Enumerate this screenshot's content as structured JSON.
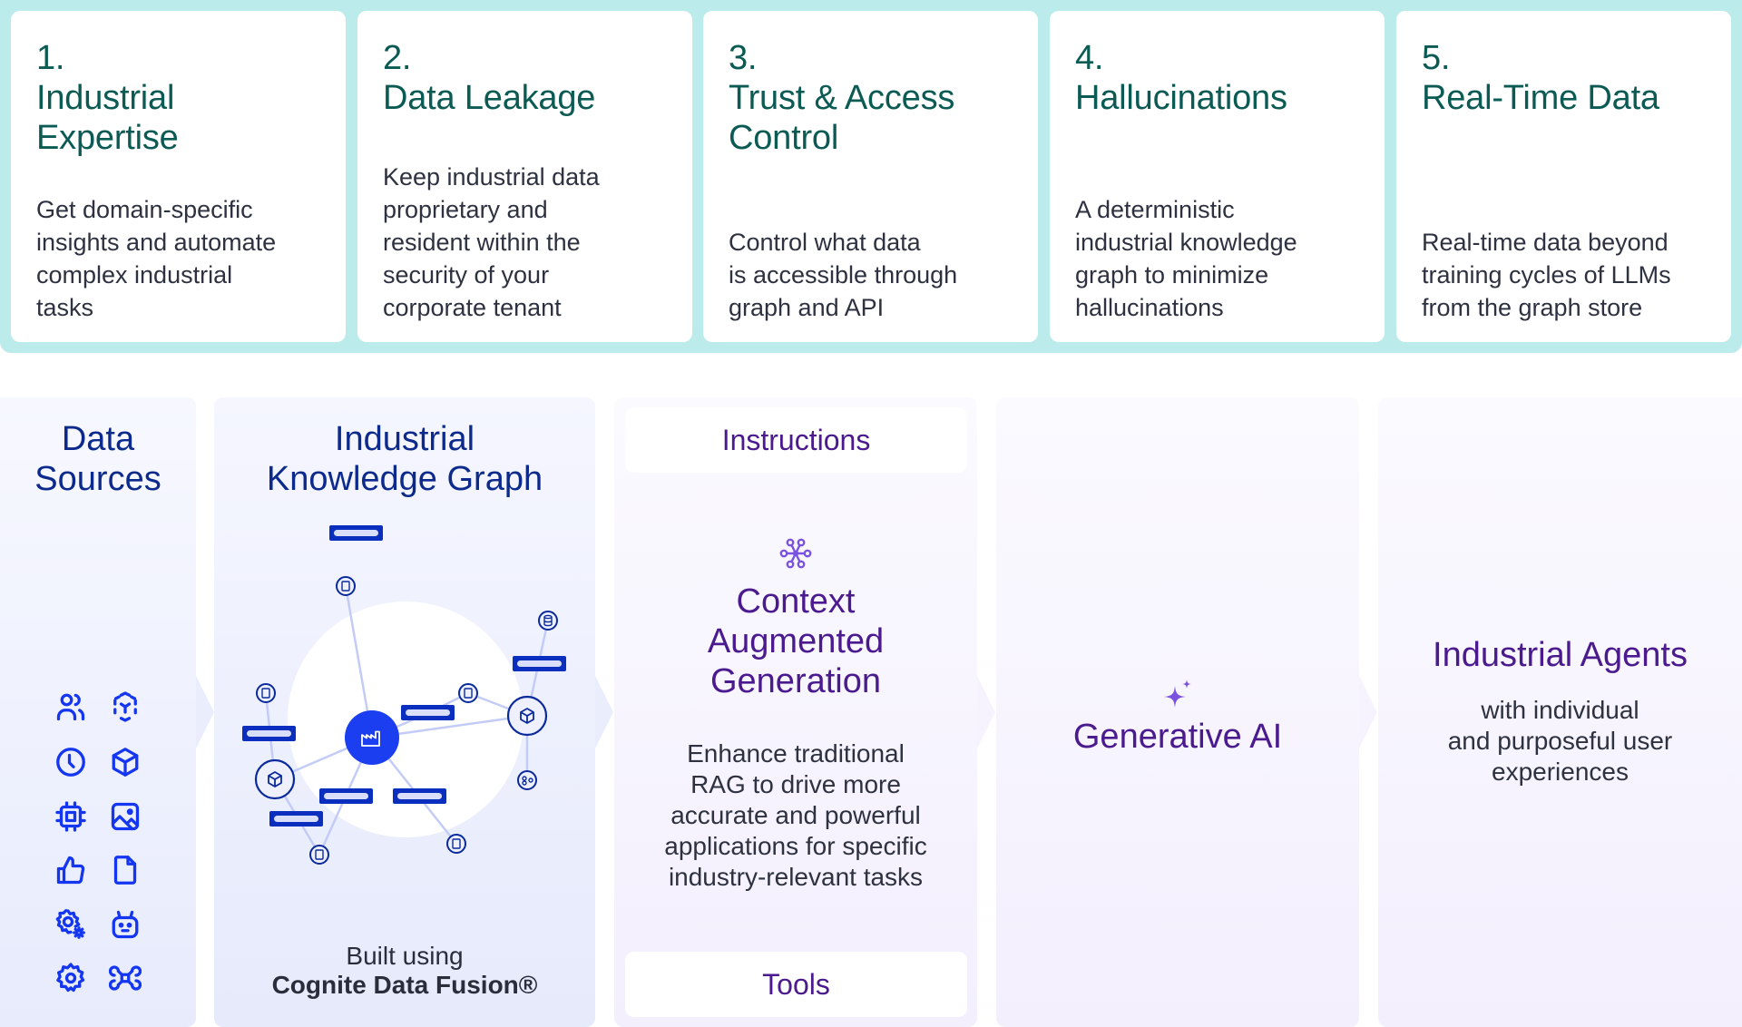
{
  "challenges": [
    {
      "number": "1.",
      "title": "Industrial\nExpertise",
      "description": "Get domain-specific\ninsights and automate\ncomplex industrial\ntasks"
    },
    {
      "number": "2.",
      "title": "Data Leakage",
      "description": "Keep industrial data\nproprietary and\nresident within the\nsecurity of your\ncorporate tenant"
    },
    {
      "number": "3.",
      "title": "Trust & Access\nControl",
      "description": "Control what data\nis accessible through\ngraph and API"
    },
    {
      "number": "4.",
      "title": "Hallucinations",
      "description": "A deterministic\nindustrial knowledge\ngraph to minimize\nhallucinations"
    },
    {
      "number": "5.",
      "title": "Real-Time Data",
      "description": "Real-time data beyond\ntraining cycles of LLMs\nfrom the graph store"
    }
  ],
  "data_sources": {
    "title": "Data\nSources",
    "icons": [
      "users-icon",
      "3d-scan-icon",
      "clock-icon",
      "cube-icon",
      "chip-icon",
      "image-icon",
      "thumbs-up-icon",
      "file-icon",
      "settings-cog-icon",
      "robot-icon",
      "gear-icon",
      "drone-icon"
    ]
  },
  "knowledge_graph": {
    "title": "Industrial\nKnowledge Graph",
    "hub_icon": "factory-icon",
    "built_using": "Built using",
    "product": "Cognite Data Fusion®"
  },
  "cag": {
    "instructions": "Instructions",
    "icon": "network-hub-icon",
    "title": "Context\nAugmented\nGeneration",
    "description": "Enhance traditional\nRAG to drive more\naccurate and powerful\napplications for specific\nindustry-relevant tasks",
    "tools": "Tools"
  },
  "generative_ai": {
    "icon": "sparkle-icon",
    "title": "Generative AI"
  },
  "agents": {
    "title": "Industrial Agents",
    "description": "with individual\nand purposeful user\nexperiences"
  },
  "colors": {
    "band": "#bbebea",
    "teal_text": "#0b5b54",
    "blue_title": "#0c2a8c",
    "graph_blue": "#1a3ef0",
    "graph_navy": "#0a2fbf",
    "purple_title": "#4a1a8e",
    "purple_icon": "#7b52e0"
  }
}
